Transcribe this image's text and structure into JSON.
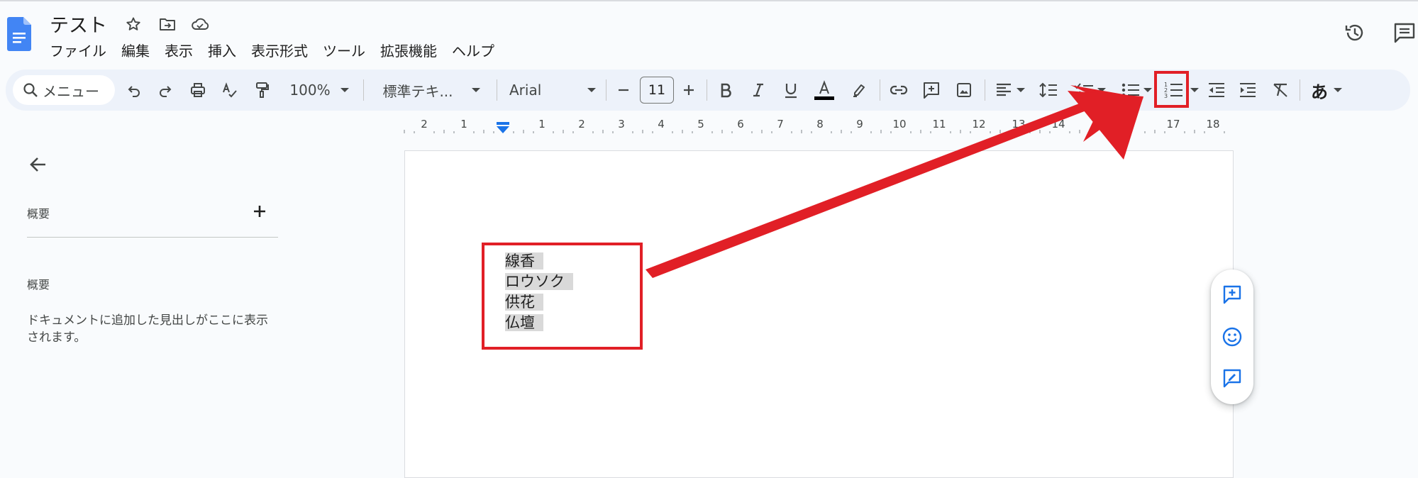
{
  "header": {
    "title": "テスト",
    "menu": [
      "ファイル",
      "編集",
      "表示",
      "挿入",
      "表示形式",
      "ツール",
      "拡張機能",
      "ヘルプ"
    ]
  },
  "toolbar": {
    "search_label": "メニュー",
    "zoom": "100%",
    "style": "標準テキ...",
    "font": "Arial",
    "font_size": "11",
    "input_mode": "あ"
  },
  "ruler": {
    "labels": [
      "2",
      "1",
      "1",
      "2",
      "3",
      "4",
      "5",
      "6",
      "7",
      "8",
      "9",
      "10",
      "11",
      "12",
      "13",
      "14",
      "17",
      "18"
    ]
  },
  "outline_panel": {
    "heading": "概要",
    "section_heading": "概要",
    "help_text": "ドキュメントに追加した見出しがここに表示されます。"
  },
  "document": {
    "lines": [
      "線香",
      "ロウソク",
      "供花",
      "仏壇"
    ]
  },
  "colors": {
    "annotation": "#e11f26",
    "accent": "#1a73e8",
    "toolbar_bg": "#edf2fa"
  },
  "icons": {
    "highlighted_button": "numbered-list-icon"
  }
}
